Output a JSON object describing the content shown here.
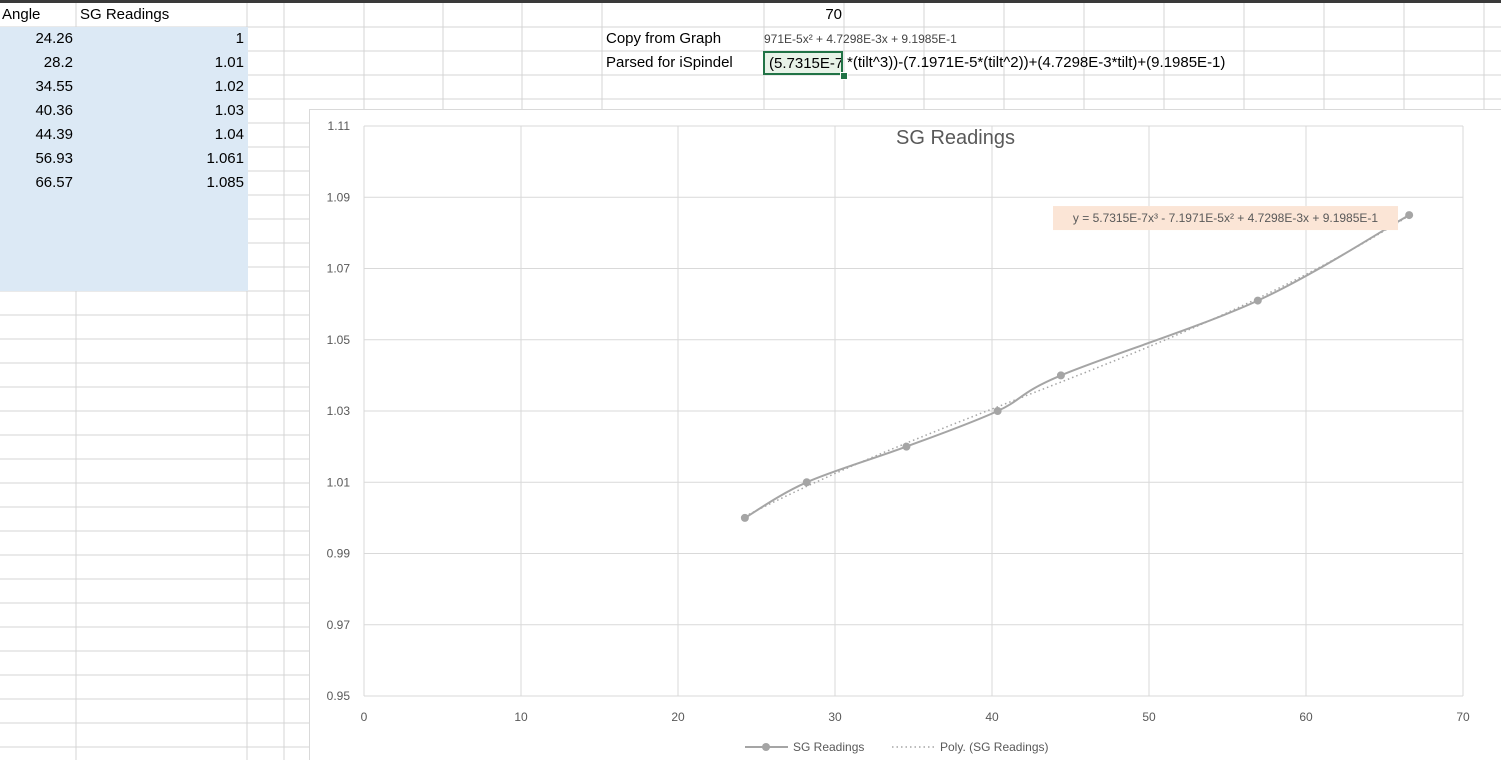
{
  "spreadsheet": {
    "headers": {
      "angle": "Angle",
      "sg": "SG Readings"
    },
    "rows": [
      {
        "angle": "24.26",
        "sg": "1"
      },
      {
        "angle": "28.2",
        "sg": "1.01"
      },
      {
        "angle": "34.55",
        "sg": "1.02"
      },
      {
        "angle": "40.36",
        "sg": "1.03"
      },
      {
        "angle": "44.39",
        "sg": "1.04"
      },
      {
        "angle": "56.93",
        "sg": "1.061"
      },
      {
        "angle": "66.57",
        "sg": "1.085"
      }
    ],
    "top_value": "70",
    "copy_label": "Copy from Graph",
    "copy_value": "971E-5x² + 4.7298E-3x + 9.1985E-1",
    "parsed_label": "Parsed for iSpindel",
    "parsed_cell": "(5.7315E-7",
    "parsed_overflow": "*(tilt^3))-(7.1971E-5*(tilt^2))+(4.7298E-3*tilt)+(9.1985E-1)"
  },
  "colors": {
    "selection_green": "#217346",
    "highlight_blue": "#dce9f5",
    "series_gray": "#a5a5a5",
    "equation_bg": "#fbe5d6"
  },
  "chart_data": {
    "type": "scatter",
    "title": "SG Readings",
    "xlim": [
      0,
      70
    ],
    "ylim": [
      0.95,
      1.11
    ],
    "x_ticks": [
      "0",
      "10",
      "20",
      "30",
      "40",
      "50",
      "60",
      "70"
    ],
    "y_ticks": [
      "1.11",
      "1.09",
      "1.07",
      "1.05",
      "1.03",
      "1.01",
      "0.99",
      "0.97",
      "0.95"
    ],
    "grid": true,
    "legend_position": "bottom",
    "series": [
      {
        "name": "SG Readings",
        "x": [
          24.26,
          28.2,
          34.55,
          40.36,
          44.39,
          56.93,
          66.57
        ],
        "y": [
          1.0,
          1.01,
          1.02,
          1.03,
          1.04,
          1.061,
          1.085
        ],
        "style": "smooth-line-markers"
      }
    ],
    "trendline": {
      "name": "Poly. (SG Readings)",
      "coefficients": [
        5.7315e-07,
        -7.1971e-05,
        0.0047298,
        0.91985
      ],
      "style": "dotted"
    },
    "equation_label": "y = 5.7315E-7x³ - 7.1971E-5x² + 4.7298E-3x + 9.1985E-1"
  }
}
